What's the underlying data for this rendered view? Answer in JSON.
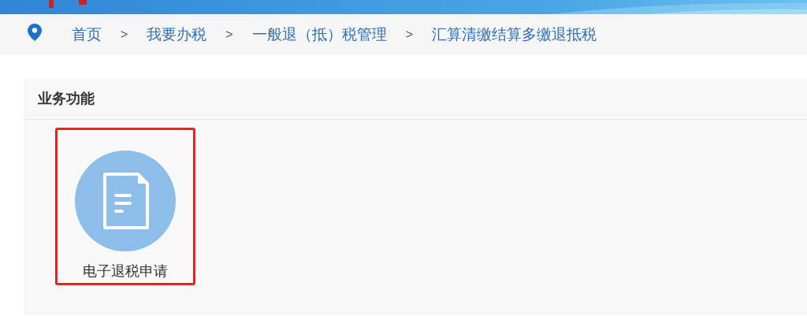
{
  "breadcrumb": {
    "items": [
      {
        "label": "首页"
      },
      {
        "label": "我要办税"
      },
      {
        "label": "一般退（抵）税管理"
      },
      {
        "label": "汇算清缴结算多缴退抵税"
      }
    ],
    "separator": ">"
  },
  "panel": {
    "title": "业务功能",
    "tiles": [
      {
        "label": "电子退税申请",
        "highlighted": true
      }
    ]
  }
}
